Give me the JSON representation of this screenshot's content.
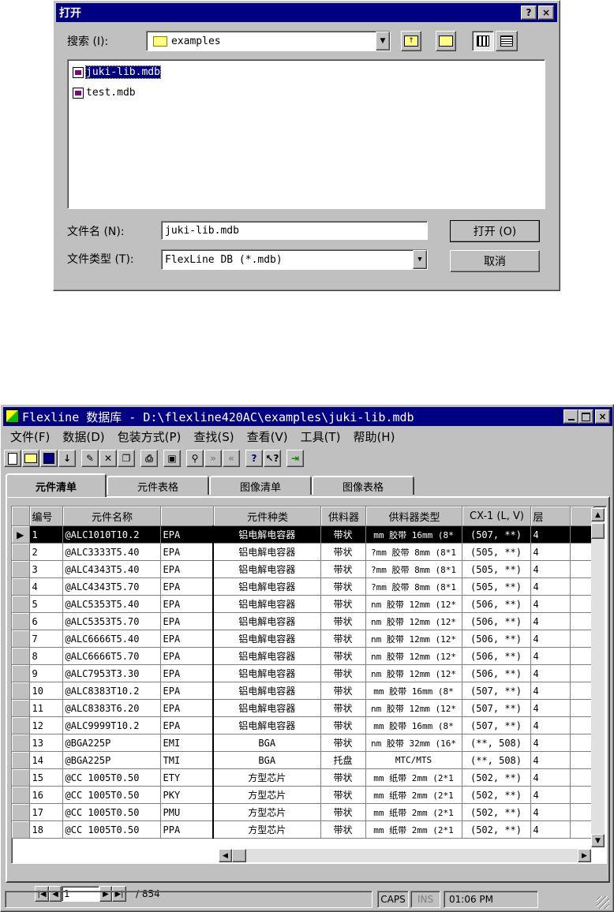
{
  "open_dialog": {
    "title": "打开",
    "help_btn": "?",
    "close_btn": "×",
    "look_in_label": "搜索 (I):",
    "look_in_value": "examples",
    "files": [
      "juki-lib.mdb",
      "test.mdb"
    ],
    "filename_label": "文件名 (N):",
    "filename_value": "juki-lib.mdb",
    "filetype_label": "文件类型 (T):",
    "filetype_value": "FlexLine DB (*.mdb)",
    "open_button": "打开 (O)",
    "cancel_button": "取消"
  },
  "main_window": {
    "title": "Flexline 数据库 - D:\\flexline420AC\\examples\\juki-lib.mdb",
    "menu": [
      "文件(F)",
      "数据(D)",
      "包装方式(P)",
      "查找(S)",
      "查看(V)",
      "工具(T)",
      "帮助(H)"
    ],
    "tabs": [
      "元件清单",
      "元件表格",
      "图像清单",
      "图像表格"
    ],
    "columns": [
      "编号",
      "元件名称",
      "",
      "元件种类",
      "供料器",
      "供料器类型",
      "CX-1 (L, V)",
      "层"
    ],
    "rows": [
      [
        "1",
        "@ALC1010T10.2",
        "EPA",
        "铝电解电容器",
        "带状",
        "mm 胶带 16mm (8*",
        "(507, **)",
        "4"
      ],
      [
        "2",
        "@ALC3333T5.40",
        "EPA",
        "铝电解电容器",
        "带状",
        "?mm 胶带 8mm (8*1",
        "(505, **)",
        "4"
      ],
      [
        "3",
        "@ALC4343T5.40",
        "EPA",
        "铝电解电容器",
        "带状",
        "?mm 胶带 8mm (8*1",
        "(505, **)",
        "4"
      ],
      [
        "4",
        "@ALC4343T5.70",
        "EPA",
        "铝电解电容器",
        "带状",
        "?mm 胶带 8mm (8*1",
        "(505, **)",
        "4"
      ],
      [
        "5",
        "@ALC5353T5.40",
        "EPA",
        "铝电解电容器",
        "带状",
        "nm 胶带 12mm (12*",
        "(506, **)",
        "4"
      ],
      [
        "6",
        "@ALC5353T5.70",
        "EPA",
        "铝电解电容器",
        "带状",
        "nm 胶带 12mm (12*",
        "(506, **)",
        "4"
      ],
      [
        "7",
        "@ALC6666T5.40",
        "EPA",
        "铝电解电容器",
        "带状",
        "nm 胶带 12mm (12*",
        "(506, **)",
        "4"
      ],
      [
        "8",
        "@ALC6666T5.70",
        "EPA",
        "铝电解电容器",
        "带状",
        "nm 胶带 12mm (12*",
        "(506, **)",
        "4"
      ],
      [
        "9",
        "@ALC7953T3.30",
        "EPA",
        "铝电解电容器",
        "带状",
        "nm 胶带 12mm (12*",
        "(506, **)",
        "4"
      ],
      [
        "10",
        "@ALC8383T10.2",
        "EPA",
        "铝电解电容器",
        "带状",
        "mm 胶带 16mm (8*",
        "(507, **)",
        "4"
      ],
      [
        "11",
        "@ALC8383T6.20",
        "EPA",
        "铝电解电容器",
        "带状",
        "nm 胶带 12mm (12*",
        "(507, **)",
        "4"
      ],
      [
        "12",
        "@ALC9999T10.2",
        "EPA",
        "铝电解电容器",
        "带状",
        "mm 胶带 16mm (8*",
        "(507, **)",
        "4"
      ],
      [
        "13",
        "@BGA225P",
        "EMI",
        "BGA",
        "带状",
        "nm 胶带 32mm (16*",
        "(**, 508)",
        "4"
      ],
      [
        "14",
        "@BGA225P",
        "TMI",
        "BGA",
        "托盘",
        "MTC/MTS",
        "(**, 508)",
        "4"
      ],
      [
        "15",
        "@CC 1005T0.50",
        "ETY",
        "方型芯片",
        "带状",
        "mm 纸带 2mm (2*1",
        "(502, **)",
        "4"
      ],
      [
        "16",
        "@CC 1005T0.50",
        "PKY",
        "方型芯片",
        "带状",
        "mm 纸带 2mm (2*1",
        "(502, **)",
        "4"
      ],
      [
        "17",
        "@CC 1005T0.50",
        "PMU",
        "方型芯片",
        "带状",
        "mm 纸带 2mm (2*1",
        "(502, **)",
        "4"
      ],
      [
        "18",
        "@CC 1005T0.50",
        "PPA",
        "方型芯片",
        "带状",
        "mm 纸带 2mm (2*1",
        "(502, **)",
        "4"
      ]
    ],
    "record_current": "1",
    "record_total": "/ 854",
    "status": {
      "caps": "CAPS",
      "ins": "INS",
      "time": "01:06 PM"
    }
  }
}
